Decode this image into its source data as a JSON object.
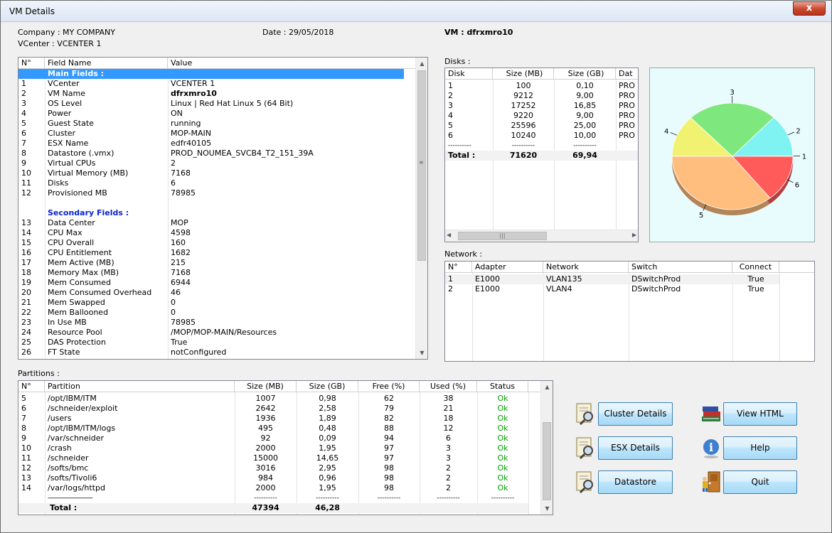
{
  "window": {
    "title": "VM Details",
    "close": "x"
  },
  "header": {
    "company": "Company : MY COMPANY",
    "vcenter": "VCenter : VCENTER 1",
    "date": "Date : 29/05/2018",
    "vm": "VM : dfrxmro10"
  },
  "fields": {
    "columns": [
      "N°",
      "Field Name",
      "Value"
    ],
    "main_title": "Main Fields :",
    "secondary_title": "Secondary Fields :",
    "main": [
      [
        "1",
        "VCenter",
        "VCENTER 1"
      ],
      [
        "2",
        "VM Name",
        "dfrxmro10"
      ],
      [
        "3",
        "OS Level",
        "Linux | Red Hat Linux 5 (64 Bit)"
      ],
      [
        "4",
        "Power",
        "ON"
      ],
      [
        "5",
        "Guest State",
        "running"
      ],
      [
        "6",
        "Cluster",
        "MOP-MAIN"
      ],
      [
        "7",
        "ESX Name",
        "edfr40105"
      ],
      [
        "8",
        "Datastore (.vmx)",
        "PROD_NOUMEA_SVCB4_T2_151_39A"
      ],
      [
        "9",
        "Virtual CPUs",
        "2"
      ],
      [
        "10",
        "Virtual Memory (MB)",
        "7168"
      ],
      [
        "11",
        "Disks",
        "6"
      ],
      [
        "12",
        "Provisioned MB",
        "78985"
      ]
    ],
    "secondary": [
      [
        "13",
        "Data Center",
        "MOP"
      ],
      [
        "14",
        "CPU Max",
        "4598"
      ],
      [
        "15",
        "CPU Overall",
        "160"
      ],
      [
        "16",
        "CPU Entitlement",
        "1682"
      ],
      [
        "17",
        "Mem Active (MB)",
        "215"
      ],
      [
        "18",
        "Memory Max (MB)",
        "7168"
      ],
      [
        "19",
        "Mem Consumed",
        "6944"
      ],
      [
        "20",
        "Mem Consumed Overhead",
        "46"
      ],
      [
        "21",
        "Mem Swapped",
        "0"
      ],
      [
        "22",
        "Mem Ballooned",
        "0"
      ],
      [
        "23",
        "In Use MB",
        "78985"
      ],
      [
        "24",
        "Resource Pool",
        "/MOP/MOP-MAIN/Resources"
      ],
      [
        "25",
        "DAS Protection",
        "True"
      ],
      [
        "26",
        "FT State",
        "notConfigured"
      ]
    ]
  },
  "disks": {
    "label": "Disks :",
    "columns": [
      "Disk",
      "Size (MB)",
      "Size (GB)",
      "Dat"
    ],
    "rows": [
      [
        "1",
        "100",
        "0,10",
        "PRO"
      ],
      [
        "2",
        "9212",
        "9,00",
        "PRO"
      ],
      [
        "3",
        "17252",
        "16,85",
        "PRO"
      ],
      [
        "4",
        "9220",
        "9,00",
        "PRO"
      ],
      [
        "5",
        "25596",
        "25,00",
        "PRO"
      ],
      [
        "6",
        "10240",
        "10,00",
        "PRO"
      ]
    ],
    "separator": [
      "----------",
      "----------",
      "----------"
    ],
    "total": [
      "Total :",
      "71620",
      "69,94"
    ],
    "hscroll_grip": "|||"
  },
  "pie": {
    "slices": [
      {
        "label": "1",
        "value": 0.1,
        "color": "#ff5b5b"
      },
      {
        "label": "2",
        "value": 9.0,
        "color": "#7ff2f2"
      },
      {
        "label": "3",
        "value": 16.85,
        "color": "#7ee87e"
      },
      {
        "label": "4",
        "value": 9.0,
        "color": "#f2f272"
      },
      {
        "label": "5",
        "value": 25.0,
        "color": "#ffbe7e"
      },
      {
        "label": "6",
        "value": 10.0,
        "color": "#ff5b5b"
      }
    ]
  },
  "network": {
    "label": "Network :",
    "columns": [
      "N°",
      "Adapter",
      "Network",
      "Switch",
      "Connect"
    ],
    "rows": [
      [
        "1",
        "E1000",
        "VLAN135",
        "DSwitchProd",
        "True"
      ],
      [
        "2",
        "E1000",
        "VLAN4",
        "DSwitchProd",
        "True"
      ]
    ]
  },
  "partitions": {
    "label": "Partitions :",
    "columns": [
      "N°",
      "Partition",
      "Size (MB)",
      "Size (GB)",
      "Free (%)",
      "Used (%)",
      "Status"
    ],
    "rows": [
      [
        "5",
        "/opt/IBM/ITM",
        "1007",
        "0,98",
        "62",
        "38",
        "Ok"
      ],
      [
        "6",
        "/schneider/exploit",
        "2642",
        "2,58",
        "79",
        "21",
        "Ok"
      ],
      [
        "7",
        "/users",
        "1936",
        "1,89",
        "82",
        "18",
        "Ok"
      ],
      [
        "8",
        "/opt/IBM/ITM/logs",
        "495",
        "0,48",
        "88",
        "12",
        "Ok"
      ],
      [
        "9",
        "/var/schneider",
        "92",
        "0,09",
        "94",
        "6",
        "Ok"
      ],
      [
        "10",
        "/crash",
        "2000",
        "1,95",
        "97",
        "3",
        "Ok"
      ],
      [
        "11",
        "/schneider",
        "15000",
        "14,65",
        "97",
        "3",
        "Ok"
      ],
      [
        "12",
        "/softs/bmc",
        "3016",
        "2,95",
        "98",
        "2",
        "Ok"
      ],
      [
        "13",
        "/softs/Tivoli6",
        "984",
        "0,96",
        "98",
        "2",
        "Ok"
      ],
      [
        "14",
        "/var/logs/httpd",
        "2000",
        "1,95",
        "98",
        "2",
        "Ok"
      ]
    ],
    "separator": [
      "----------------------------",
      "----------",
      "----------",
      "----------",
      "----------",
      "----------"
    ],
    "total": [
      "Total :",
      "47394",
      "46,28"
    ]
  },
  "buttons": {
    "cluster": "Cluster Details",
    "esx": "ESX Details",
    "datastore": "Datastore",
    "html": "View HTML",
    "help": "Help",
    "quit": "Quit"
  }
}
